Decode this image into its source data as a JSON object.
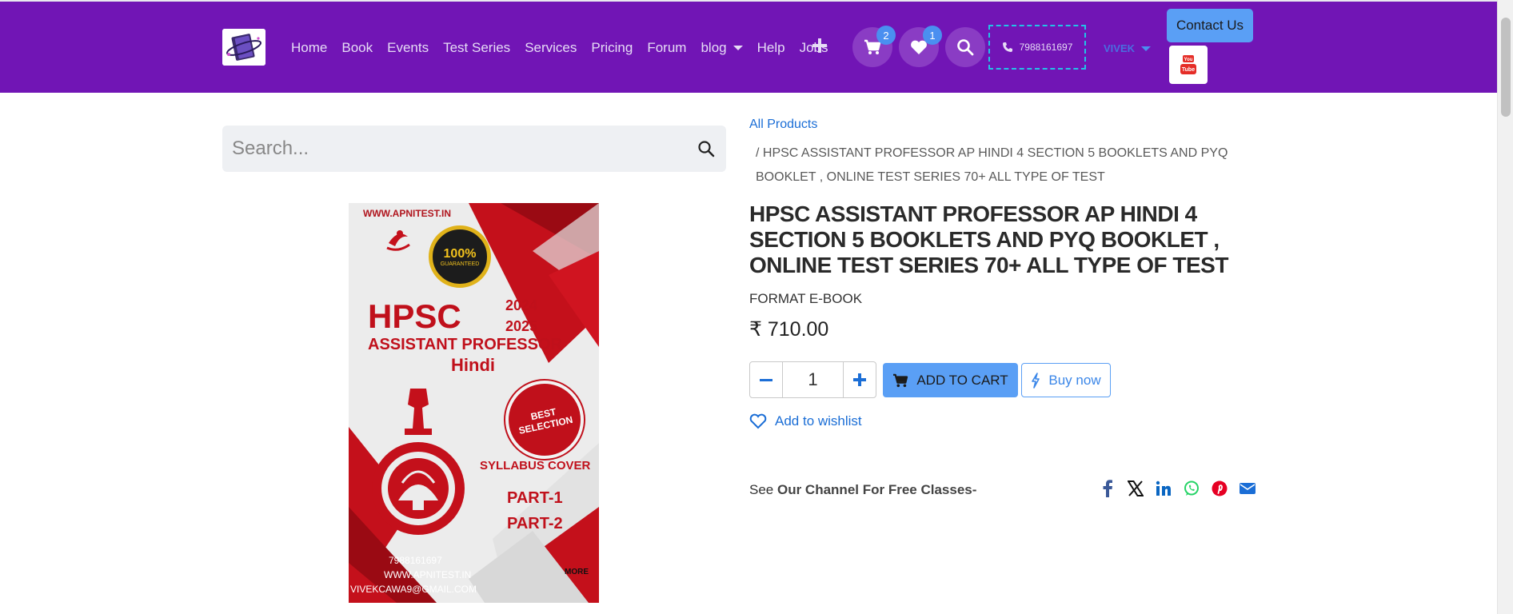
{
  "nav": {
    "links": [
      "Home",
      "Book",
      "Events",
      "Test Series",
      "Services",
      "Pricing",
      "Forum",
      "blog",
      "Help",
      "Jobs"
    ],
    "cart_count": "2",
    "wishlist_count": "1",
    "phone": "7988161697",
    "user": "VIVEK",
    "contact_label": "Contact Us"
  },
  "search": {
    "placeholder": "Search..."
  },
  "cover": {
    "url": "WWW.APNITEST.IN",
    "seal_main": "100%",
    "seal_sub": "GUARANTEED",
    "title": "HPSC",
    "year1": "2024",
    "year2": "2025",
    "subtitle": "ASSISTANT PROFESSOR",
    "subject": "Hindi",
    "badge": "BEST SELECTION",
    "syllabus": "SYLLABUS COVER",
    "part1": "PART-1",
    "part2": "PART-2",
    "phone": "7988161697",
    "web": "WWW.APNITEST.IN",
    "email": "VIVEKCAWA9@GMAIL.COM",
    "more": "MORE"
  },
  "breadcrumb": {
    "root": "All Products",
    "current": "/  HPSC ASSISTANT PROFESSOR AP HINDI 4 SECTION 5 BOOKLETS AND PYQ BOOKLET , ONLINE TEST SERIES 70+ ALL TYPE OF TEST"
  },
  "product": {
    "title": "HPSC ASSISTANT PROFESSOR AP HINDI 4 SECTION 5 BOOKLETS AND PYQ BOOKLET , ONLINE TEST SERIES 70+ ALL TYPE OF TEST",
    "format": "FORMAT E-BOOK",
    "price": "₹ 710.00",
    "quantity": "1",
    "add_to_cart": "ADD TO CART",
    "buy_now": "Buy now",
    "wishlist": "Add to wishlist",
    "channel_prefix": "See ",
    "channel_text": "Our Channel For Free Classes-"
  },
  "colors": {
    "header": "#7115b5",
    "accent": "#5a9ff5",
    "link": "#1b6ed6"
  },
  "share_icons": [
    "facebook-icon",
    "x-icon",
    "linkedin-icon",
    "whatsapp-icon",
    "pinterest-icon",
    "email-icon"
  ]
}
